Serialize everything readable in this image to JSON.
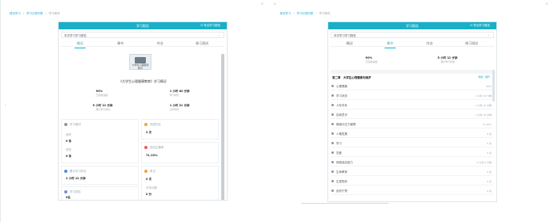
{
  "left": {
    "breadcrumb": {
      "items": [
        "首页学习",
        "学习记录列表"
      ],
      "current": "学习情况"
    },
    "header": {
      "title": "学习报告",
      "export_label": "导出学习报告"
    },
    "select": {
      "value": "本次学习学习报告"
    },
    "tabs": [
      {
        "label": "概况",
        "active": true
      },
      {
        "label": "章节",
        "active": false
      },
      {
        "label": "作业",
        "active": false
      },
      {
        "label": "练习测试",
        "active": false
      }
    ],
    "course": {
      "thumb_text": "大学生心理健康教育",
      "title": "《大学生心理健康教育》学习情况"
    },
    "stats": [
      {
        "value": "90%",
        "label": "已完成进度"
      },
      {
        "value": "1 小时 40 分钟",
        "label": "学习时长"
      },
      {
        "value": "5 小时 12 分钟",
        "label": "累计学习时长"
      },
      {
        "value": "1 小时 21 分钟",
        "label": "日均时长"
      }
    ],
    "cards": [
      {
        "title": "学习情况",
        "dot_color": "#8a96a3",
        "lines": [
          "良好",
          "0 条",
          "学完",
          "0 条"
        ]
      },
      {
        "title": "完成作业",
        "dot_color": "#f0a53a",
        "lines": [
          "2 次"
        ]
      },
      {
        "title": "测试正确率",
        "dot_color": "#f05a5a",
        "lines": [
          "71.23%"
        ]
      },
      {
        "title": "累计学习时长",
        "dot_color": "#4a90e2",
        "lines": [
          "2 小时 12 分钟"
        ]
      },
      {
        "title": "考试",
        "dot_color": "#f0a53a",
        "lines": [
          "0 次",
          "平均分数",
          "0 分"
        ]
      },
      {
        "title": "学习排名",
        "dot_color": "#7a8ce0",
        "lines": [
          "0名"
        ]
      }
    ]
  },
  "right": {
    "breadcrumb": {
      "items": [
        "首页学习",
        "学习记录列表"
      ],
      "current": "学习情况"
    },
    "header": {
      "title": "学习报告",
      "export_label": "导出学习报告"
    },
    "select": {
      "value": "本次学习学习报告"
    },
    "tabs": [
      {
        "label": "概况",
        "active": false
      },
      {
        "label": "章节",
        "active": true
      },
      {
        "label": "作业",
        "active": false
      },
      {
        "label": "练习测试",
        "active": false
      }
    ],
    "stats": [
      {
        "value": "90%",
        "label": "已完成进度"
      },
      {
        "value": "5 小时 12 分钟",
        "label": "累计学习时长"
      }
    ],
    "chapter": {
      "title": "第二章　大学生心理健康与维护",
      "action": "收起 / 展开"
    },
    "rows": [
      {
        "name": "心理健康",
        "value": "90%"
      },
      {
        "name": "学习状态",
        "value": "1 小时 10 分钟"
      },
      {
        "name": "人际关系",
        "value": "1 小时 10 分钟"
      },
      {
        "name": "自我意识",
        "value": "1 小时 10 分钟"
      },
      {
        "name": "情绪与压力管理",
        "value": "71.23%"
      },
      {
        "name": "人格发展",
        "value": "0 次"
      },
      {
        "name": "学习",
        "value": "0 次"
      },
      {
        "name": "恋爱",
        "value": "0 次"
      },
      {
        "name": "网络适应能力",
        "value": "2 小时 0 分钟"
      },
      {
        "name": "生命教育",
        "value": "0 次"
      },
      {
        "name": "生涯规划",
        "value": "0 次"
      },
      {
        "name": "危机干预",
        "value": "0 次"
      }
    ]
  },
  "colors": {
    "accent": "#1aafc8",
    "link": "#29a7cf"
  }
}
